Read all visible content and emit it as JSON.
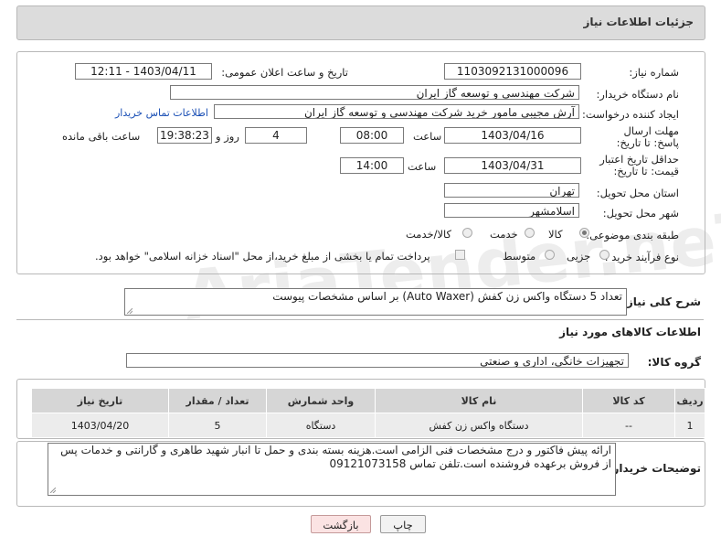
{
  "header": {
    "title": "جزئیات اطلاعات نیاز"
  },
  "form": {
    "need_number": {
      "label": "شماره نیاز:",
      "value": "1103092131000096"
    },
    "announce": {
      "label": "تاریخ و ساعت اعلان عمومی:",
      "value": "1403/04/11 - 12:11"
    },
    "buyer": {
      "label": "نام دستگاه خریدار:",
      "value": "شرکت مهندسي و توسعه گاز ايران"
    },
    "creator": {
      "label": "ایجاد کننده درخواست:",
      "value": "آرش مجيبي مامور خريد شرکت مهندسي و توسعه گاز ايران",
      "contact_link": "اطلاعات تماس خریدار"
    },
    "reply_deadline": {
      "label": "مهلت ارسال پاسخ: تا تاریخ:",
      "date": "1403/04/16",
      "time_label": "ساعت",
      "time": "08:00",
      "days": "4",
      "days_label": "روز و",
      "remain": "19:38:23",
      "remain_label": "ساعت باقی مانده"
    },
    "validity": {
      "label": "حداقل تاریخ اعتبار قیمت: تا تاریخ:",
      "date": "1403/04/31",
      "time_label": "ساعت",
      "time": "14:00"
    },
    "province": {
      "label": "استان محل تحویل:",
      "value": "تهران"
    },
    "city": {
      "label": "شهر محل تحویل:",
      "value": "اسلامشهر"
    },
    "category": {
      "label": "طبقه بندی موضوعی:",
      "options": [
        "کالا",
        "خدمت",
        "کالا/خدمت"
      ],
      "selected": "کالا"
    },
    "purchase_type": {
      "label": "نوع فرآیند خرید :",
      "options": [
        "جزیی",
        "متوسط"
      ],
      "note": "پرداخت تمام یا بخشی از مبلغ خرید،از محل \"اسناد خزانه اسلامی\" خواهد بود."
    }
  },
  "description": {
    "label": "شرح کلی نیاز:",
    "value": "تعداد 5 دستگاه واکس زن کفش (Auto Waxer) بر اساس مشخصات پیوست"
  },
  "goods_section": {
    "title": "اطلاعات کالاهای مورد نیاز",
    "group_label": "گروه کالا:",
    "group_value": "تجهیزات خانگی، اداری و صنعتی"
  },
  "table": {
    "headers": [
      "ردیف",
      "کد کالا",
      "نام کالا",
      "واحد شمارش",
      "تعداد / مقدار",
      "تاریخ نیاز"
    ],
    "rows": [
      [
        "1",
        "--",
        "دستگاه واکس زن کفش",
        "دستگاه",
        "5",
        "1403/04/20"
      ]
    ]
  },
  "buyer_notes": {
    "label": "توضیحات خریدار:",
    "value": "ارائه پیش فاکتور و درج مشخصات فنی الزامی است.هزینه بسته بندی و حمل تا انبار شهید طاهری و گارانتی و خدمات پس از فروش برعهده فروشنده است.تلفن تماس 09121073158"
  },
  "buttons": {
    "print": "چاپ",
    "back": "بازگشت"
  },
  "watermark": "AriaTender.neT",
  "colors": {
    "link": "#1a4fb5",
    "back_button": "#fbe3e3",
    "header_bg": "#dcdcdc"
  }
}
